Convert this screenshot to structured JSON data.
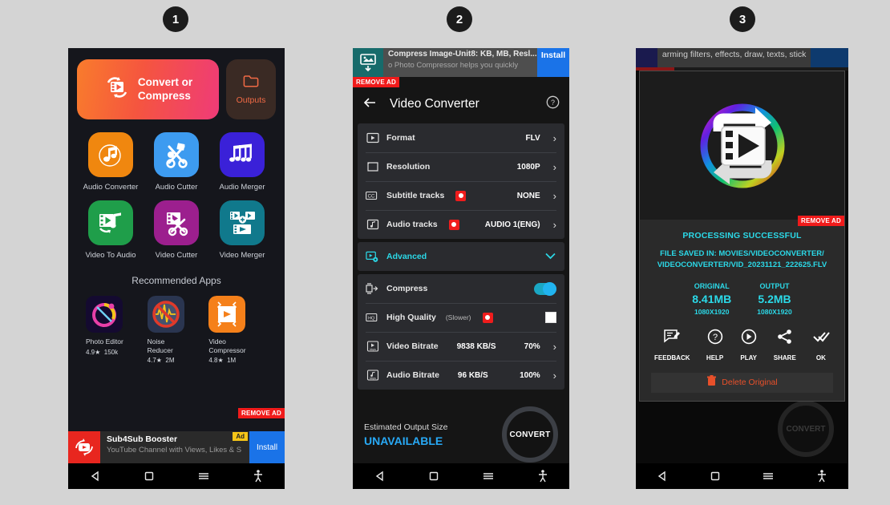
{
  "steps": [
    {
      "number": "1"
    },
    {
      "number": "2"
    },
    {
      "number": "3"
    }
  ],
  "colors": {
    "accent_cyan": "#2bd9e8",
    "accent_orange": "#e8502a",
    "accent_blue": "#28a9f5",
    "remove_ad_red": "#f01b1b",
    "install_blue": "#1a73e8"
  },
  "phone1": {
    "convert_card": {
      "label_line1": "Convert or",
      "label_line2": "Compress",
      "icon": "convert-video-icon"
    },
    "outputs_card": {
      "label": "Outputs",
      "icon": "folder-icon"
    },
    "tools": [
      {
        "label": "Audio Converter",
        "icon": "music-note-circle-icon",
        "color": "#f0870f"
      },
      {
        "label": "Audio Cutter",
        "icon": "scissors-audio-icon",
        "color": "#3d9bf0"
      },
      {
        "label": "Audio Merger",
        "icon": "music-notes-icon",
        "color": "#3a21d8"
      },
      {
        "label": "Video To Audio",
        "icon": "video-to-audio-icon",
        "color": "#1f9e4a"
      },
      {
        "label": "Video Cutter",
        "icon": "video-cutter-icon",
        "color": "#9c1f8e"
      },
      {
        "label": "Video Merger",
        "icon": "video-merger-icon",
        "color": "#10798c"
      }
    ],
    "recommended_title": "Recommended Apps",
    "recommended": [
      {
        "name_line1": "Photo Editor",
        "name_line2": "",
        "rating": "4.9",
        "downloads": "150k",
        "icon": "photo-editor-icon"
      },
      {
        "name_line1": "Noise",
        "name_line2": "Reducer",
        "rating": "4.7",
        "downloads": "2M",
        "icon": "noise-reducer-icon"
      },
      {
        "name_line1": "Video",
        "name_line2": "Compressor",
        "rating": "4.8",
        "downloads": "1M",
        "icon": "video-compressor-icon"
      }
    ],
    "remove_ad_label": "REMOVE AD",
    "ad_banner": {
      "title": "Sub4Sub Booster",
      "subtitle": "YouTube Channel with Views, Likes & S",
      "tag": "Ad",
      "install_label": "Install",
      "icon": "sub4sub-icon"
    }
  },
  "phone2": {
    "top_ad": {
      "title": "Compress Image-Unit8: KB, MB, Resl...",
      "subtitle": "o Photo Compressor helps you quickly",
      "install_label": "Install",
      "icon": "image-compress-icon"
    },
    "remove_ad_label": "REMOVE AD",
    "header": {
      "title": "Video Converter",
      "back_icon": "back-arrow-icon",
      "help_icon": "help-circle-icon"
    },
    "settings_rows": [
      {
        "label": "Format",
        "value": "FLV",
        "icon": "format-icon",
        "badge": false
      },
      {
        "label": "Resolution",
        "value": "1080P",
        "icon": "resolution-icon",
        "badge": false
      },
      {
        "label": "Subtitle tracks",
        "value": "NONE",
        "icon": "subtitle-cc-icon",
        "badge": true
      },
      {
        "label": "Audio tracks",
        "value": "AUDIO 1(ENG)",
        "icon": "audio-track-icon",
        "badge": true
      }
    ],
    "advanced": {
      "label": "Advanced",
      "icon": "advanced-gear-icon",
      "chevron": "chevron-down-icon"
    },
    "compress": {
      "label": "Compress",
      "icon": "compress-icon",
      "enabled": true
    },
    "high_quality": {
      "label": "High Quality",
      "sublabel": "(Slower)",
      "icon": "hq-icon",
      "badge": true,
      "checked": false
    },
    "bitrate_rows": [
      {
        "label": "Video Bitrate",
        "value": "9838 KB/S",
        "percent": "70%",
        "icon": "video-bitrate-icon"
      },
      {
        "label": "Audio Bitrate",
        "value": "96 KB/S",
        "percent": "100%",
        "icon": "audio-bitrate-icon"
      }
    ],
    "footer": {
      "estimate_label": "Estimated Output Size",
      "estimate_value": "UNAVAILABLE",
      "convert_label": "CONVERT"
    }
  },
  "phone3": {
    "top_ad": {
      "text": "arming filters, effects, draw, texts, stick"
    },
    "remove_ad_label": "REMOVE AD",
    "logo_icon": "video-converter-logo",
    "success_label": "PROCESSING SUCCESSFUL",
    "file_path_line1": "FILE SAVED IN: MOVIES/VIDEOCONVERTER/",
    "file_path_line2": "VIDEOCONVERTER/VID_20231121_222625.FLV",
    "sizes": [
      {
        "label": "ORIGINAL",
        "value": "8.41MB",
        "dimensions": "1080X1920"
      },
      {
        "label": "OUTPUT",
        "value": "5.2MB",
        "dimensions": "1080X1920"
      }
    ],
    "actions": [
      {
        "label": "FEEDBACK",
        "icon": "feedback-icon"
      },
      {
        "label": "HELP",
        "icon": "help-circle-icon"
      },
      {
        "label": "PLAY",
        "icon": "play-circle-icon"
      },
      {
        "label": "SHARE",
        "icon": "share-icon"
      },
      {
        "label": "OK",
        "icon": "double-check-icon"
      }
    ],
    "delete_label": "Delete Original",
    "delete_icon": "trash-icon",
    "ghost_convert_label": "CONVERT"
  },
  "navbar": {
    "back_icon": "nav-back-triangle-icon",
    "home_icon": "nav-home-square-icon",
    "recents_icon": "nav-recents-icon",
    "accessibility_icon": "nav-accessibility-icon"
  }
}
